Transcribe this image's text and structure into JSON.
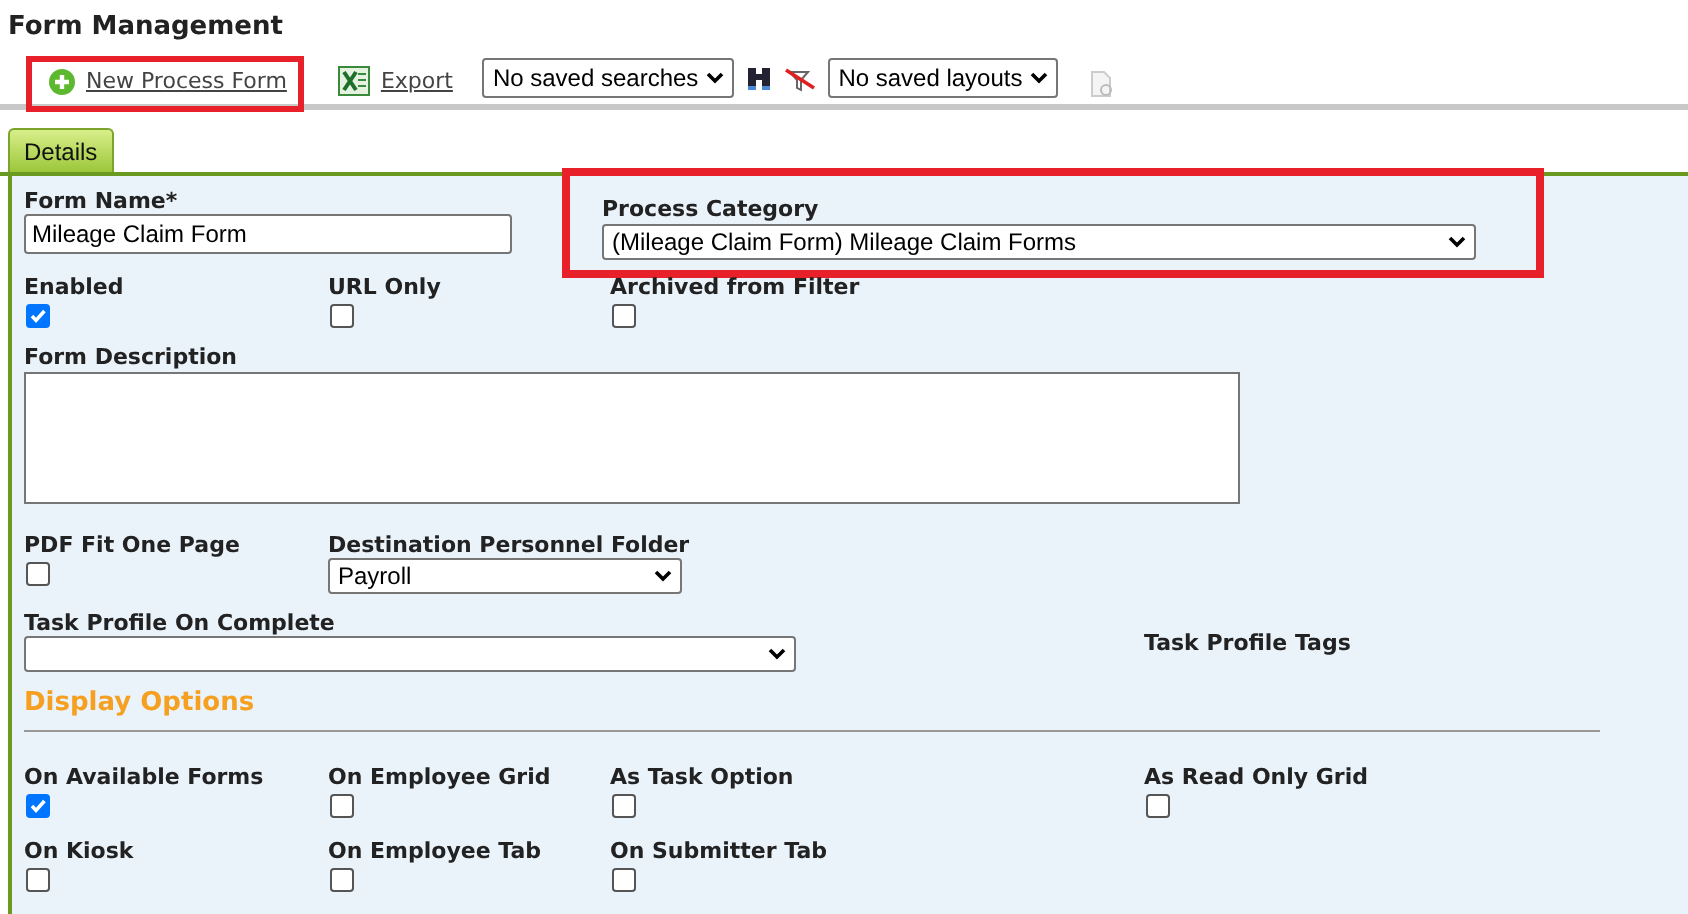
{
  "title": "Form Management",
  "toolbar": {
    "new_link": {
      "label": "New Process Form",
      "highlighted": true
    },
    "export_link": {
      "label": "Export"
    },
    "saved_searches": {
      "value": "No saved searches"
    },
    "saved_layouts": {
      "value": "No saved layouts"
    }
  },
  "tabs": [
    {
      "label": "Details",
      "selected": true
    }
  ],
  "rows": [
    {
      "fields": [
        {
          "kind": "text",
          "label": "Form Name*",
          "value": "Mileage Claim Form"
        },
        {
          "kind": "select",
          "label": "Process Category",
          "value": "(Mileage Claim Form) Mileage Claim Forms",
          "highlighted": true
        }
      ]
    },
    {
      "fields": [
        {
          "kind": "checkbox",
          "label": "Enabled",
          "checked": true
        },
        {
          "kind": "checkbox",
          "label": "URL Only",
          "checked": false
        },
        {
          "kind": "checkbox",
          "label": "Archived from Filter",
          "checked": false
        }
      ]
    },
    {
      "fields": [
        {
          "kind": "textarea",
          "label": "Form Description"
        }
      ]
    },
    {
      "fields": [
        {
          "kind": "checkbox",
          "label": "PDF Fit One Page",
          "checked": false
        },
        {
          "kind": "select",
          "label": "Destination Personnel Folder",
          "value": "Payroll"
        }
      ]
    },
    {
      "fields": [
        {
          "kind": "select",
          "label": "Task Profile On Complete"
        },
        {
          "kind": "label",
          "label": "Task Profile Tags"
        }
      ]
    }
  ],
  "section": {
    "title": "Display Options"
  },
  "display_rows": [
    {
      "fields": [
        {
          "kind": "checkbox",
          "label": "On Available Forms",
          "checked": true
        },
        {
          "kind": "checkbox",
          "label": "On Employee Grid",
          "checked": false
        },
        {
          "kind": "checkbox",
          "label": "As Task Option",
          "checked": false
        },
        {
          "kind": "checkbox",
          "label": "As Read Only Grid",
          "checked": false
        }
      ]
    },
    {
      "fields": [
        {
          "kind": "checkbox",
          "label": "On Kiosk",
          "checked": false
        },
        {
          "kind": "checkbox",
          "label": "On Employee Tab",
          "checked": false
        },
        {
          "kind": "checkbox",
          "label": "On Submitter Tab",
          "checked": false
        }
      ]
    }
  ]
}
